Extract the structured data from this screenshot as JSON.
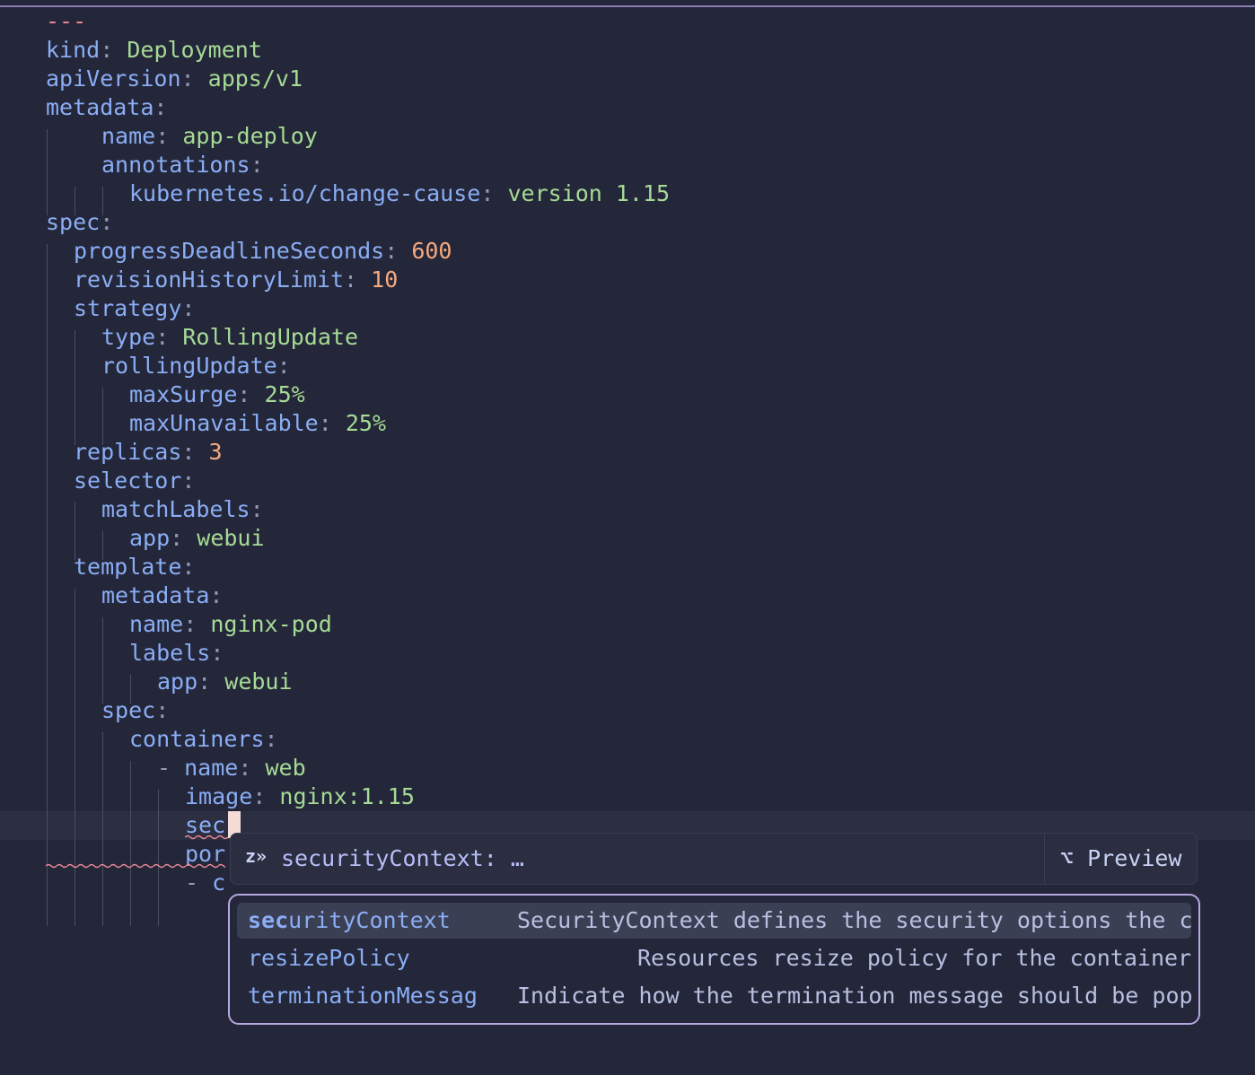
{
  "editor": {
    "lines": [
      {
        "key": "---",
        "type": "doc"
      },
      {
        "key": "kind",
        "value": "Deployment",
        "vtype": "s"
      },
      {
        "key": "apiVersion",
        "value": "apps/v1",
        "vtype": "s"
      },
      {
        "key": "metadata"
      },
      {
        "key": "name",
        "value": "app-deploy",
        "vtype": "s"
      },
      {
        "key": "annotations"
      },
      {
        "key": "kubernetes.io/change-cause",
        "value": "version 1.15",
        "vtype": "s"
      },
      {
        "key": "spec"
      },
      {
        "key": "progressDeadlineSeconds",
        "value": "600",
        "vtype": "n"
      },
      {
        "key": "revisionHistoryLimit",
        "value": "10",
        "vtype": "n"
      },
      {
        "key": "strategy"
      },
      {
        "key": "type",
        "value": "RollingUpdate",
        "vtype": "s"
      },
      {
        "key": "rollingUpdate"
      },
      {
        "key": "maxSurge",
        "value": "25%",
        "vtype": "s"
      },
      {
        "key": "maxUnavailable",
        "value": "25%",
        "vtype": "s"
      },
      {
        "key": "replicas",
        "value": "3",
        "vtype": "n"
      },
      {
        "key": "selector"
      },
      {
        "key": "matchLabels"
      },
      {
        "key": "app",
        "value": "webui",
        "vtype": "s"
      },
      {
        "key": "template"
      },
      {
        "key": "metadata"
      },
      {
        "key": "name",
        "value": "nginx-pod",
        "vtype": "s"
      },
      {
        "key": "labels"
      },
      {
        "key": "app",
        "value": "webui",
        "vtype": "s"
      },
      {
        "key": "spec"
      },
      {
        "key": "containers"
      },
      {
        "dash": "-",
        "key": "name",
        "value": "web",
        "vtype": "s"
      },
      {
        "key": "image",
        "value": "nginx:1.15",
        "vtype": "s"
      },
      {
        "key": "sec",
        "current": true
      },
      {
        "key": "por"
      },
      {
        "dash": "-",
        "key": "c"
      }
    ],
    "colon": ":"
  },
  "inline_hint": {
    "icon": "z»",
    "text": "securityContext: …",
    "preview_icon": "⌥",
    "preview_label": "Preview"
  },
  "completions": [
    {
      "label_match": "sec",
      "label_rest": "urityContext",
      "detail": "SecurityContext defines the security options the co",
      "selected": true
    },
    {
      "label_match": "",
      "label_rest": "resizePolicy",
      "detail": "Resources resize policy for the container.",
      "selected": false
    },
    {
      "label_match": "",
      "label_rest": "terminationMessag",
      "detail": "Indicate how the termination message should be popu",
      "selected": false
    }
  ],
  "colors": {
    "background": "#24273a",
    "key": "#8aadf4",
    "string": "#a6da95",
    "number": "#f5a97f",
    "error": "#ed8796",
    "menu_border": "#b7a8e0"
  }
}
